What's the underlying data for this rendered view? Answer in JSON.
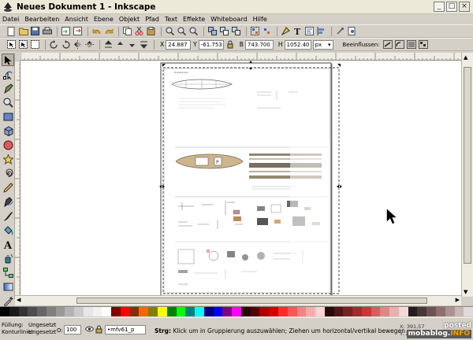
{
  "window": {
    "title": "Neues Dokument 1 - Inkscape"
  },
  "menu": [
    "Datei",
    "Bearbeiten",
    "Ansicht",
    "Ebene",
    "Objekt",
    "Pfad",
    "Text",
    "Effekte",
    "Whiteboard",
    "Hilfe"
  ],
  "toolbar2": {
    "x_label": "X",
    "x_value": "24.887",
    "y_label": "Y",
    "y_value": "-61.753",
    "w_label": "B",
    "w_value": "743.700",
    "h_label": "H",
    "h_value": "1052.40",
    "unit": "px",
    "affect_label": "Beeinflussen:"
  },
  "tools": [
    "selector-tool-icon",
    "node-tool-icon",
    "tweak-tool-icon",
    "zoom-tool-icon",
    "rectangle-tool-icon",
    "3d-box-tool-icon",
    "ellipse-tool-icon",
    "star-tool-icon",
    "spiral-tool-icon",
    "pencil-tool-icon",
    "pen-tool-icon",
    "calligraphy-tool-icon",
    "paint-bucket-tool-icon",
    "text-tool-icon",
    "spray-tool-icon",
    "connector-tool-icon",
    "gradient-tool-icon",
    "dropper-tool-icon"
  ],
  "palette": [
    "#000000",
    "#1a1a1a",
    "#333333",
    "#4d4d4d",
    "#666666",
    "#808080",
    "#999999",
    "#b3b3b3",
    "#cccccc",
    "#e6e6e6",
    "#f2f2f2",
    "#ffffff",
    "#800000",
    "#ff0000",
    "#803300",
    "#ff6600",
    "#808000",
    "#ffff00",
    "#008000",
    "#00ff00",
    "#008080",
    "#00ffff",
    "#000080",
    "#0000ff",
    "#800080",
    "#ff00ff",
    "#2b0000",
    "#550000",
    "#aa0000",
    "#d40000",
    "#ff2a2a",
    "#ff5555",
    "#ff8080",
    "#ffaaaa",
    "#ffd5d5",
    "#280b0b",
    "#501616",
    "#782121",
    "#a02c2c",
    "#c83737",
    "#d35f5f",
    "#de8787",
    "#e9afaf",
    "#f4d7d7",
    "#241c1c",
    "#483737",
    "#6c5353",
    "#916f6f",
    "#ac9393",
    "#c8b7b7",
    "#e3dbdb"
  ],
  "status": {
    "fill_label": "Füllung:",
    "fill_value": "Ungesetzt",
    "stroke_label": "Konturlinie:",
    "stroke_value": "Ungesetzt",
    "opacity_label": "O:",
    "opacity_value": "100",
    "layer": "•mfv61_p",
    "message_key": "Strg:",
    "message_text": " Klick um in Gruppierung auszuwählen; Ziehen um horizontal/vertikal bewegen",
    "coord_x": "X: 391,57",
    "coord_y": "Y: 280,76"
  },
  "watermark": {
    "posted": "posted",
    "brand_a": "mobablog.",
    "brand_b": "INFO"
  }
}
